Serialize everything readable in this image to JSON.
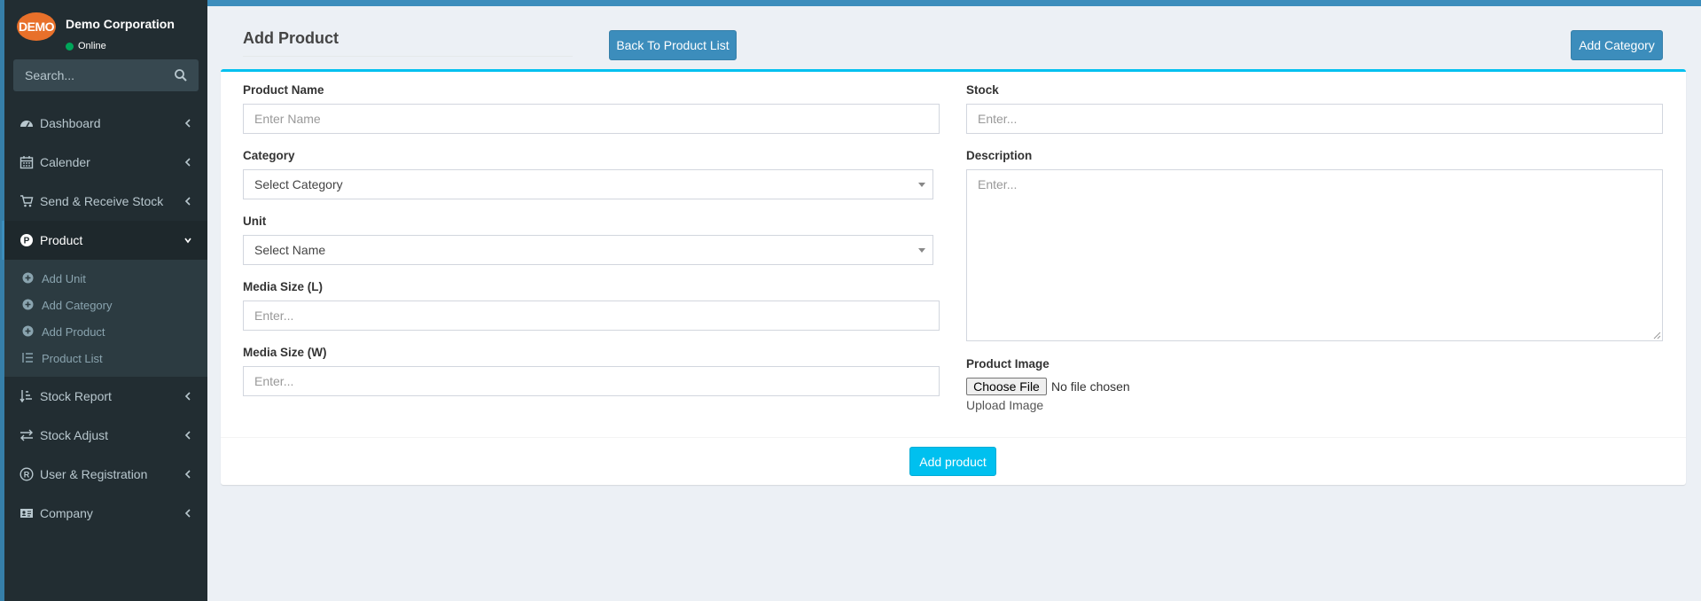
{
  "company": {
    "avatar_text": "DEMO",
    "name": "Demo Corporation",
    "status": "Online",
    "status_color": "#00a65a"
  },
  "search": {
    "placeholder": "Search..."
  },
  "menu": {
    "items": [
      {
        "label": "Dashboard",
        "icon": "dashboard-icon"
      },
      {
        "label": "Calender",
        "icon": "calendar-icon"
      },
      {
        "label": "Send & Receive Stock",
        "icon": "cart-icon"
      },
      {
        "label": "Product",
        "icon": "product-p-icon",
        "active": true
      },
      {
        "label": "Stock Report",
        "icon": "sort-list-icon"
      },
      {
        "label": "Stock Adjust",
        "icon": "exchange-icon"
      },
      {
        "label": "User & Registration",
        "icon": "registered-icon"
      },
      {
        "label": "Company",
        "icon": "id-card-icon"
      }
    ],
    "product_submenu": [
      {
        "label": "Add Unit",
        "icon": "plus-circle-icon"
      },
      {
        "label": "Add Category",
        "icon": "plus-circle-icon"
      },
      {
        "label": "Add Product",
        "icon": "plus-circle-icon"
      },
      {
        "label": "Product List",
        "icon": "list-icon"
      }
    ]
  },
  "page": {
    "title": "Add Product",
    "back_button": "Back To Product List",
    "add_category_button": "Add Category"
  },
  "form": {
    "product_name": {
      "label": "Product Name",
      "placeholder": "Enter Name"
    },
    "category": {
      "label": "Category",
      "value": "Select Category"
    },
    "unit": {
      "label": "Unit",
      "value": "Select Name"
    },
    "media_size_l": {
      "label": "Media Size (L)",
      "placeholder": "Enter..."
    },
    "media_size_w": {
      "label": "Media Size (W)",
      "placeholder": "Enter..."
    },
    "stock": {
      "label": "Stock",
      "placeholder": "Enter..."
    },
    "description": {
      "label": "Description",
      "placeholder": "Enter..."
    },
    "product_image": {
      "label": "Product Image",
      "button": "Choose File",
      "status": "No file chosen",
      "hint": "Upload Image"
    },
    "submit": "Add product"
  },
  "colors": {
    "sidebar_bg": "#222d32",
    "accent": "#3c8dbc",
    "info": "#00c0ef"
  }
}
